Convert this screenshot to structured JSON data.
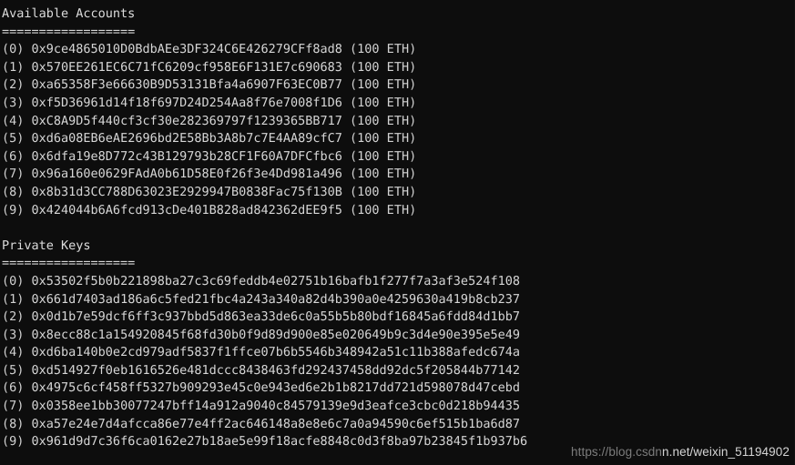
{
  "terminal": {
    "background_color": "#0d0d0d",
    "text_color": "#d6d6d6",
    "sections": [
      {
        "title": "Available Accounts",
        "rule": "==================",
        "entries": [
          {
            "index": "(0)",
            "value": "0x9ce4865010D0BdbAEe3DF324C6E426279CFf8ad8",
            "suffix": "(100 ETH)"
          },
          {
            "index": "(1)",
            "value": "0x570EE261EC6C71fC6209cf958E6F131E7c690683",
            "suffix": "(100 ETH)"
          },
          {
            "index": "(2)",
            "value": "0xa65358F3e66630B9D53131Bfa4a6907F63EC0B77",
            "suffix": "(100 ETH)"
          },
          {
            "index": "(3)",
            "value": "0xf5D36961d14f18f697D24D254Aa8f76e7008f1D6",
            "suffix": "(100 ETH)"
          },
          {
            "index": "(4)",
            "value": "0xC8A9D5f440cf3cf30e282369797f1239365BB717",
            "suffix": "(100 ETH)"
          },
          {
            "index": "(5)",
            "value": "0xd6a08EB6eAE2696bd2E58Bb3A8b7c7E4AA89cfC7",
            "suffix": "(100 ETH)"
          },
          {
            "index": "(6)",
            "value": "0x6dfa19e8D772c43B129793b28CF1F60A7DFCfbc6",
            "suffix": "(100 ETH)"
          },
          {
            "index": "(7)",
            "value": "0x96a160e0629FAdA0b61D58E0f26f3e4Dd981a496",
            "suffix": "(100 ETH)"
          },
          {
            "index": "(8)",
            "value": "0x8b31d3CC788D63023E2929947B0838Fac75f130B",
            "suffix": "(100 ETH)"
          },
          {
            "index": "(9)",
            "value": "0x424044b6A6fcd913cDe401B828ad842362dEE9f5",
            "suffix": "(100 ETH)"
          }
        ]
      },
      {
        "title": "Private Keys",
        "rule": "==================",
        "entries": [
          {
            "index": "(0)",
            "value": "0x53502f5b0b221898ba27c3c69feddb4e02751b16bafb1f277f7a3af3e524f108",
            "suffix": ""
          },
          {
            "index": "(1)",
            "value": "0x661d7403ad186a6c5fed21fbc4a243a340a82d4b390a0e4259630a419b8cb237",
            "suffix": ""
          },
          {
            "index": "(2)",
            "value": "0x0d1b7e59dcf6ff3c937bbd5d863ea33de6c0a55b5b80bdf16845a6fdd84d1bb7",
            "suffix": ""
          },
          {
            "index": "(3)",
            "value": "0x8ecc88c1a154920845f68fd30b0f9d89d900e85e020649b9c3d4e90e395e5e49",
            "suffix": ""
          },
          {
            "index": "(4)",
            "value": "0xd6ba140b0e2cd979adf5837f1ffce07b6b5546b348942a51c11b388afedc674a",
            "suffix": ""
          },
          {
            "index": "(5)",
            "value": "0xd514927f0eb1616526e481dccc8438463fd292437458dd92dc5f205844b77142",
            "suffix": ""
          },
          {
            "index": "(6)",
            "value": "0x4975c6cf458ff5327b909293e45c0e943ed6e2b1b8217dd721d598078d47cebd",
            "suffix": ""
          },
          {
            "index": "(7)",
            "value": "0x0358ee1bb30077247bff14a912a9040c84579139e9d3eafce3cbc0d218b94435",
            "suffix": ""
          },
          {
            "index": "(8)",
            "value": "0xa57e24e7d4afcca86e77e4ff2ac646148a8e8e6c7a0a94590c6ef515b1ba6d87",
            "suffix": ""
          },
          {
            "index": "(9)",
            "value": "0x961d9d7c36f6ca0162e27b18ae5e99f18acfe8848c0d3f8ba97b23845f1b937b6",
            "suffix": ""
          }
        ]
      }
    ]
  },
  "watermark": {
    "text": "n.net/weixin_51194902",
    "faint_text": "https://blog.csdn"
  }
}
